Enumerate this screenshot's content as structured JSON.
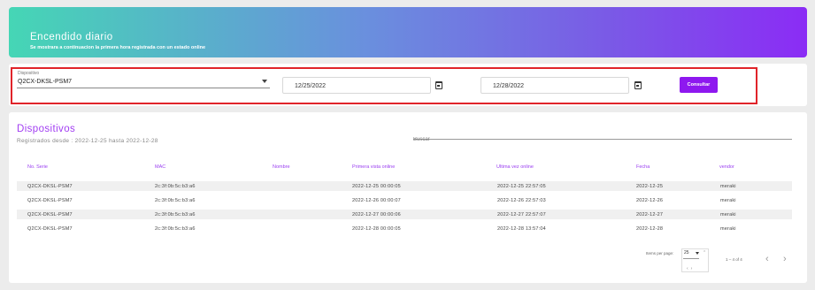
{
  "header": {
    "title": "Encendido diario",
    "subtitle": "Se mostrara a continuacion la primera hora registrada con un estado online"
  },
  "filters": {
    "device_label": "Dispositivo",
    "device_value": "Q2CX-DKSL-PSM7",
    "date_from": "12/25/2022",
    "date_to": "12/28/2022",
    "submit_label": "Consultar"
  },
  "devices": {
    "title": "Dispositivos",
    "subtitle": "Registrados desde : 2022-12-25 hasta 2022-12-28",
    "search_placeholder": "Buscar"
  },
  "table": {
    "columns": [
      "No. Serie",
      "MAC",
      "Nombre",
      "Primera vista online",
      "Ultima vez online",
      "Fecha",
      "vendor"
    ],
    "rows": [
      [
        "Q2CX-DKSL-PSM7",
        "2c:3f:0b:5c:b3:a6",
        "",
        "2022-12-25 00:00:05",
        "2022-12-25 22:57:05",
        "2022-12-25",
        "meraki"
      ],
      [
        "Q2CX-DKSL-PSM7",
        "2c:3f:0b:5c:b3:a6",
        "",
        "2022-12-26 00:00:07",
        "2022-12-26 22:57:03",
        "2022-12-26",
        "meraki"
      ],
      [
        "Q2CX-DKSL-PSM7",
        "2c:3f:0b:5c:b3:a6",
        "",
        "2022-12-27 00:00:06",
        "2022-12-27 22:57:07",
        "2022-12-27",
        "meraki"
      ],
      [
        "Q2CX-DKSL-PSM7",
        "2c:3f:0b:5c:b3:a6",
        "",
        "2022-12-28 00:00:05",
        "2022-12-28 13:57:04",
        "2022-12-28",
        "meraki"
      ]
    ]
  },
  "paginator": {
    "items_per_page_label": "Items per page:",
    "items_per_page_value": "25",
    "range_label": "1 – 4 of 4",
    "prev_icon": "‹",
    "next_icon": "›"
  },
  "colors": {
    "accent": "#8e18ef",
    "highlight_border": "#e0242a",
    "gradient_start": "#45d6b5",
    "gradient_end": "#8b2cf5"
  }
}
